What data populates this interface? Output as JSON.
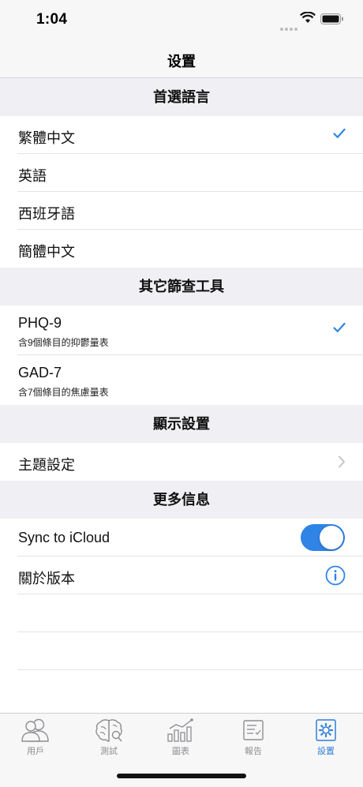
{
  "status": {
    "time": "1:04"
  },
  "nav": {
    "title": "设置"
  },
  "sections": {
    "language": {
      "header": "首選語言",
      "items": [
        {
          "label": "繁體中文",
          "selected": true
        },
        {
          "label": "英語"
        },
        {
          "label": "西班牙語"
        },
        {
          "label": "簡體中文"
        }
      ]
    },
    "tools": {
      "header": "其它篩查工具",
      "items": [
        {
          "label": "PHQ-9",
          "detail": "含9個條目的抑鬱量表",
          "selected": true
        },
        {
          "label": "GAD-7",
          "detail": "含7個條目的焦慮量表"
        }
      ]
    },
    "display": {
      "header": "顯示設置",
      "items": [
        {
          "label": "主題設定"
        }
      ]
    },
    "more": {
      "header": "更多信息",
      "items": [
        {
          "label": "Sync to iCloud",
          "toggle_on": true
        },
        {
          "label": "關於版本"
        }
      ]
    }
  },
  "tabbar": {
    "items": [
      {
        "label": "用戶",
        "icon": "users-icon"
      },
      {
        "label": "測試",
        "icon": "brain-icon"
      },
      {
        "label": "圖表",
        "icon": "chart-icon"
      },
      {
        "label": "報告",
        "icon": "report-icon"
      },
      {
        "label": "設置",
        "icon": "settings-icon",
        "active": true
      }
    ]
  },
  "colors": {
    "accent": "#2f84e5",
    "inactive": "#8e8e93",
    "group_bg": "#efeff4"
  }
}
